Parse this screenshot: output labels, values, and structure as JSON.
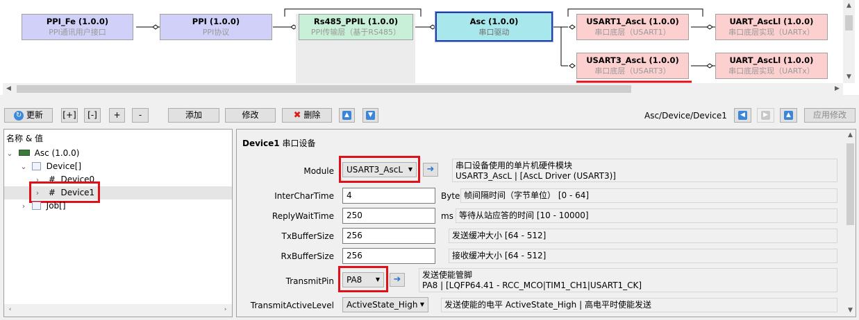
{
  "diagram": {
    "nodes": [
      {
        "id": "ppi_fe",
        "title": "PPI_Fe (1.0.0)",
        "sub": "PPI通讯用户接口"
      },
      {
        "id": "ppi",
        "title": "PPI (1.0.0)",
        "sub": "PPI协议"
      },
      {
        "id": "rs485",
        "title": "Rs485_PPIL (1.0.0)",
        "sub": "PPI传输层（基于RS485）"
      },
      {
        "id": "asc",
        "title": "Asc (1.0.0)",
        "sub": "串口驱动"
      },
      {
        "id": "usart1",
        "title": "USART1_AscL (1.0.0)",
        "sub": "串口底层（USART1）"
      },
      {
        "id": "uart1",
        "title": "UART_AscLl (1.0.0)",
        "sub": "串口底层实现（UARTx）"
      },
      {
        "id": "usart3",
        "title": "USART3_AscL (1.0.0)",
        "sub": "串口底层（USART3）"
      },
      {
        "id": "uart3",
        "title": "UART_AscLl (1.0.0)",
        "sub": "串口底层实现（UARTx）"
      }
    ],
    "colors": {
      "purple": "#d0d0f8",
      "green": "#c8f0d8",
      "cyan": "#a8e8ec",
      "pink": "#fdd0d0",
      "highlight": "#e0101a"
    }
  },
  "toolbar": {
    "refresh": "更新",
    "expand_all": "[+]",
    "collapse_all": "[-]",
    "expand": "+",
    "collapse": "-",
    "add": "添加",
    "modify": "修改",
    "delete": "删除",
    "path": "Asc/Device/Device1",
    "apply": "应用修改",
    "icons": {
      "refresh": "refresh-icon",
      "delete": "delete-x-icon",
      "up": "arrow-up-icon",
      "down": "arrow-down-icon",
      "back": "arrow-left-icon",
      "forward": "arrow-right-icon"
    }
  },
  "tree": {
    "header": "名称 & 值",
    "items": [
      {
        "label": "Asc (1.0.0)"
      },
      {
        "label": "Device[]"
      },
      {
        "label": "#  Device0"
      },
      {
        "label": "#  Device1"
      },
      {
        "label": "Job[]"
      }
    ]
  },
  "props": {
    "title": "Device1",
    "subtitle": "串口设备",
    "rows": [
      {
        "label": "Module",
        "value": "USART3_AscL",
        "unit": "",
        "desc1": "串口设备使用的单片机硬件模块",
        "desc2": "USART3_AscL | [AscL Driver (USART3)]"
      },
      {
        "label": "InterCharTime",
        "value": "4",
        "unit": "Byte",
        "desc1": "帧间隔时间（字节单位） [0 - 64]",
        "desc2": ""
      },
      {
        "label": "ReplyWaitTime",
        "value": "250",
        "unit": "ms",
        "desc1": "等待从站应答的时间 [10 - 10000]",
        "desc2": ""
      },
      {
        "label": "TxBufferSize",
        "value": "256",
        "unit": "",
        "desc1": "发送缓冲大小 [64 - 512]",
        "desc2": ""
      },
      {
        "label": "RxBufferSize",
        "value": "256",
        "unit": "",
        "desc1": "接收缓冲大小 [64 - 512]",
        "desc2": ""
      },
      {
        "label": "TransmitPin",
        "value": "PA8",
        "unit": "",
        "desc1": "发送使能管脚",
        "desc2": "PA8 | [LQFP64.41 - RCC_MCO|TIM1_CH1|USART1_CK]"
      },
      {
        "label": "TransmitActiveLevel",
        "value": "ActiveState_High",
        "unit": "",
        "desc1": "发送使能的电平 ActiveState_High | 高电平时使能发送",
        "desc2": ""
      }
    ]
  }
}
